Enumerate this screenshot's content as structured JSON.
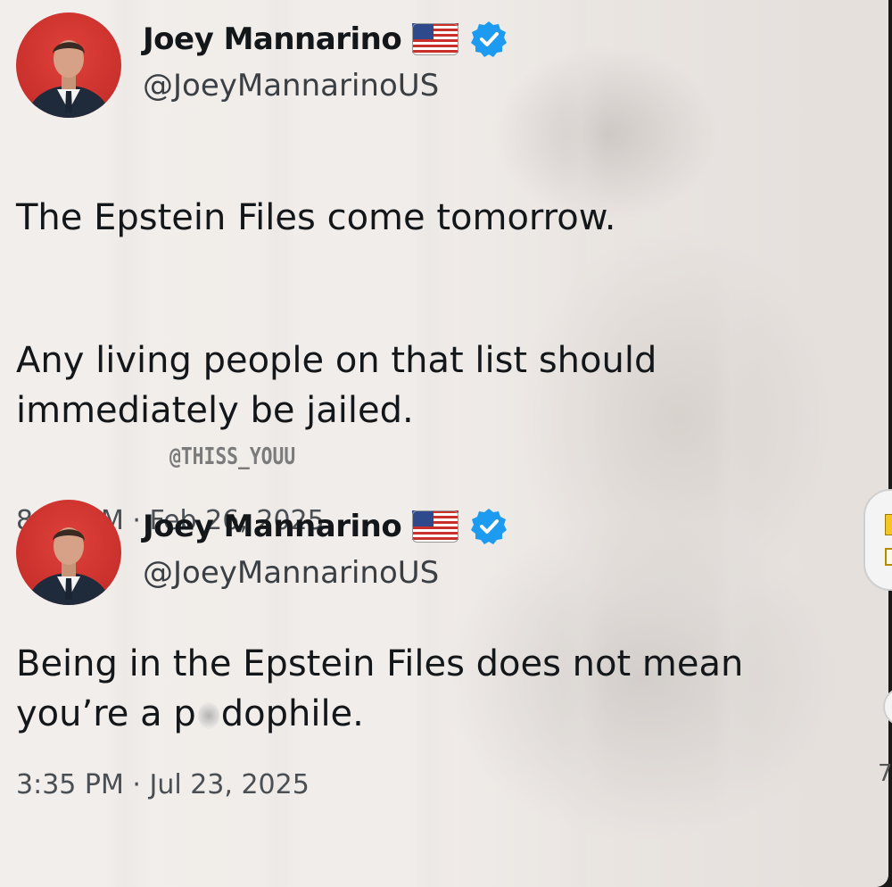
{
  "tweets": [
    {
      "display_name": "Joey Mannarino",
      "handle": "@JoeyMannarinoUS",
      "flag": "us-flag-icon",
      "verified": "verified-badge-icon",
      "paragraphs": [
        "The Epstein Files come tomorrow.",
        "Any living people on that list should immediately be jailed."
      ],
      "timestamp": "8:40 PM · Feb 26, 2025"
    },
    {
      "display_name": "Joey Mannarino",
      "handle": "@JoeyMannarinoUS",
      "flag": "us-flag-icon",
      "verified": "verified-badge-icon",
      "text_before_blur": "Being in the Epstein Files does not mean you’re a p",
      "text_after_blur": "dophile.",
      "timestamp": "3:35 PM · Jul 23, 2025"
    }
  ],
  "watermark": "@THISS_YOUU",
  "edge_digit": "7",
  "colors": {
    "avatar_bg": "#d0352f",
    "verified_blue": "#1d9bf0",
    "text": "#14171a",
    "muted": "#4a4f54"
  }
}
